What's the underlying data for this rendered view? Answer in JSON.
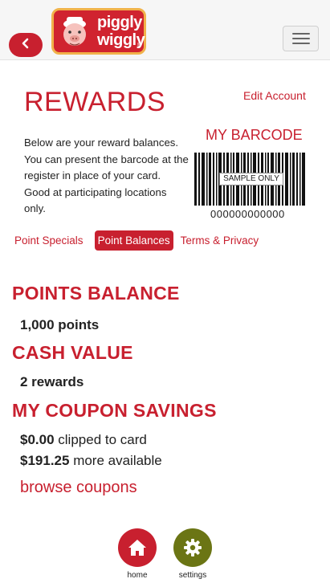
{
  "header": {
    "logo_line1": "piggly",
    "logo_line2": "wiggly",
    "logo_reg": "®",
    "back_icon": "chevron-left-icon",
    "menu_icon": "hamburger-icon"
  },
  "page": {
    "title": "REWARDS",
    "edit_account": "Edit Account",
    "description": "Below are your reward balances. You can present the barcode at the register in place of your card. Good at participating locations only."
  },
  "barcode": {
    "title": "MY BARCODE",
    "label": "SAMPLE ONLY",
    "number": "000000000000"
  },
  "tabs": [
    {
      "label": "Point Specials",
      "active": false
    },
    {
      "label": "Point Balances",
      "active": true
    },
    {
      "label": "Terms & Privacy",
      "active": false
    }
  ],
  "points": {
    "title": "POINTS BALANCE",
    "value": "1,000 points"
  },
  "cash": {
    "title": "CASH VALUE",
    "value": "2 rewards"
  },
  "coupons": {
    "title": "MY COUPON SAVINGS",
    "clipped_amount": "$0.00",
    "clipped_text": "clipped to card",
    "available_amount": "$191.25",
    "available_text": "more available",
    "browse": "browse coupons"
  },
  "nav": {
    "home_label": "home",
    "home_icon": "home-icon",
    "settings_label": "settings",
    "settings_icon": "gear-icon"
  },
  "colors": {
    "brand_red": "#c8202f",
    "settings_olive": "#6b7514"
  }
}
